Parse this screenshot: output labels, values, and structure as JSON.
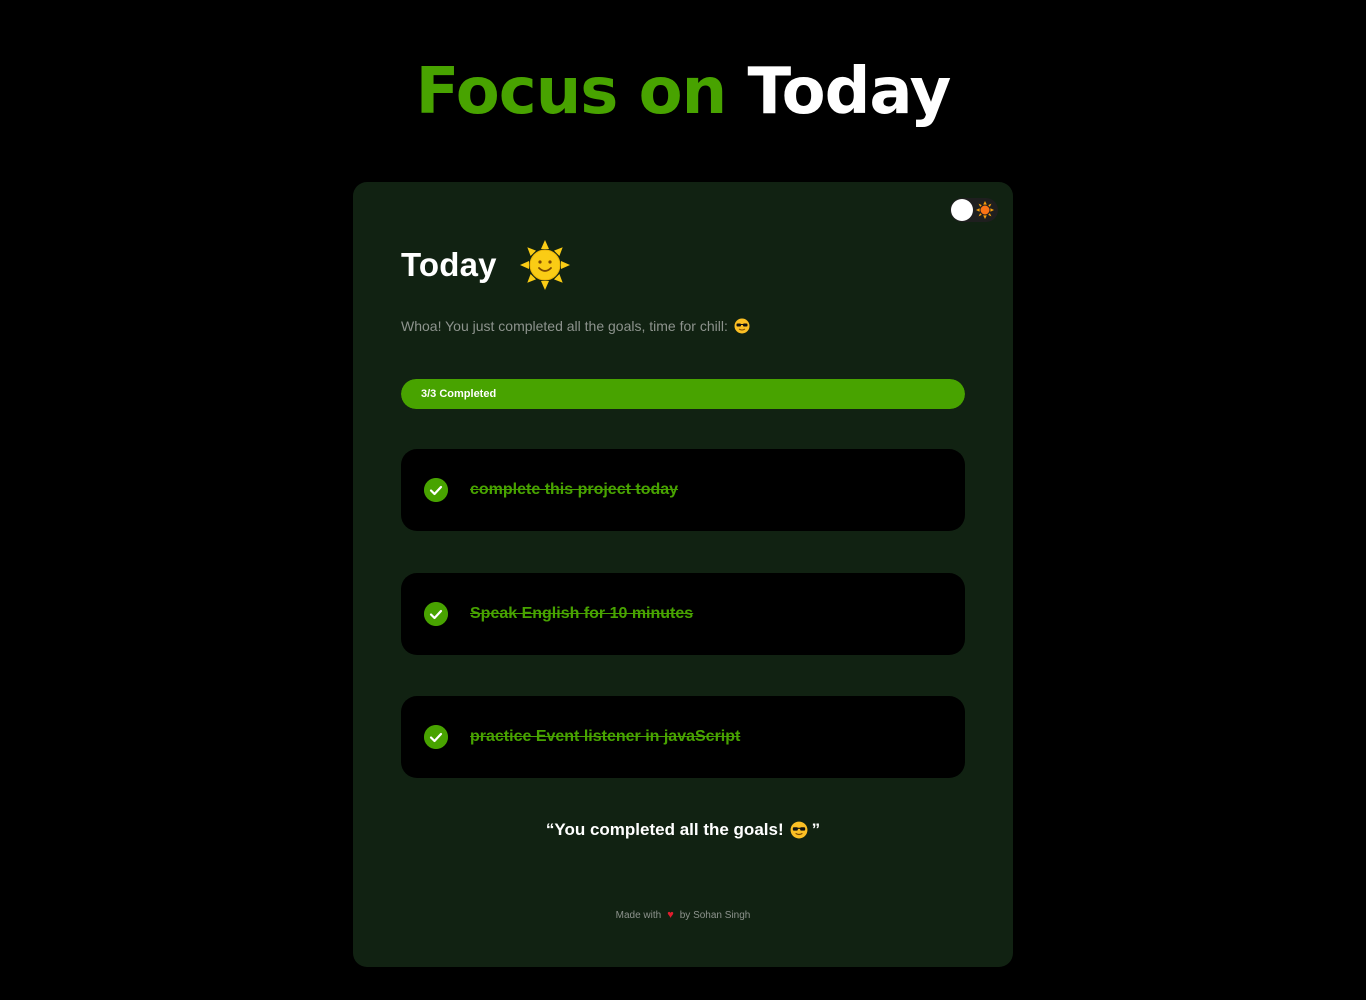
{
  "header": {
    "title_accent": "Focus on",
    "title_plain": "Today",
    "accent_color": "#48a300"
  },
  "card": {
    "title": "Today",
    "title_icon": "smiling-sun-icon",
    "theme_toggle": {
      "state": "light",
      "icon": "sun-icon"
    },
    "subtitle": "Whoa! You just completed all the goals, time for chill:",
    "subtitle_icon": "sunglasses-face-icon",
    "progress": {
      "label": "3/3 Completed",
      "completed": 3,
      "total": 3,
      "fraction": 1.0
    },
    "goals": [
      {
        "text": "complete this project today",
        "completed": true
      },
      {
        "text": "Speak English for 10 minutes",
        "completed": true
      },
      {
        "text": "practice Event listener in javaScript",
        "completed": true
      }
    ],
    "quote_open": "“You completed all the goals!",
    "quote_close": "”",
    "quote_icon": "sunglasses-face-icon",
    "footer": {
      "made_with": "Made with",
      "heart_icon": "heart-icon",
      "by": "by Sohan Singh"
    }
  }
}
